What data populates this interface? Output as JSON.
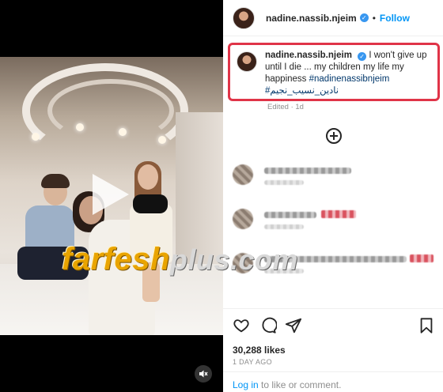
{
  "post": {
    "username": "nadine.nassib.njeim",
    "follow_label": "Follow",
    "separator": "•"
  },
  "caption": {
    "username": "nadine.nassib.njeim",
    "text": " I won't give up until I die ... my children my life my happiness ",
    "hashtag_1": "#nadinenassibnjeim",
    "hashtag_2": "#نادين_نسيب_نجيم",
    "edited": "Edited · 1d"
  },
  "watermark": {
    "part_1": "farfesh",
    "part_2": "plus.com"
  },
  "stats": {
    "likes": "30,288 likes",
    "time_ago": "1 DAY AGO"
  },
  "login": {
    "link_label": "Log in",
    "rest_text": " to like or comment."
  },
  "icons": {
    "verified": "verified-badge-icon",
    "load_more": "plus-circle-icon",
    "like": "heart-icon",
    "comment": "comment-bubble-icon",
    "share": "paper-plane-icon",
    "save": "bookmark-icon",
    "play": "play-icon",
    "mute": "speaker-muted-icon"
  },
  "colors": {
    "accent_blue": "#0095f6",
    "verified_blue": "#3897f0",
    "highlight_red": "#e03448",
    "hashtag_blue": "#00376b",
    "watermark_orange": "#e9a400"
  }
}
